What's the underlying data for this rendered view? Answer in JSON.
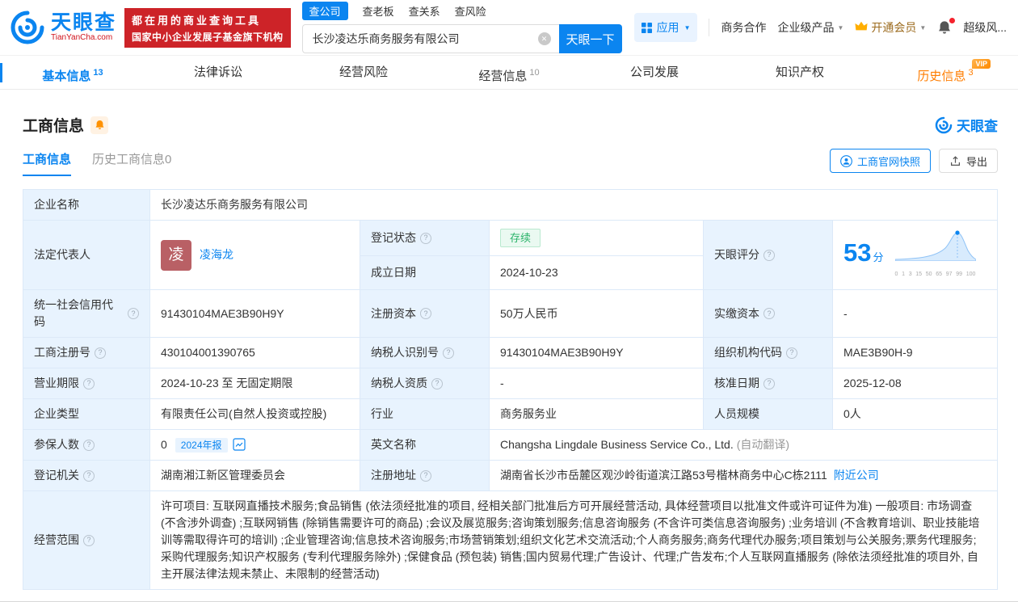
{
  "icons": {
    "help": "?",
    "clear": "✕",
    "caret": "▼"
  },
  "badges": {
    "vip": "VIP"
  },
  "header": {
    "logo_title": "天眼查",
    "logo_domain": "TianYanCha.com",
    "slogan_line1": "都在用的商业查询工具",
    "slogan_line2": "国家中小企业发展子基金旗下机构",
    "search_tabs": [
      {
        "label": "查公司"
      },
      {
        "label": "查老板"
      },
      {
        "label": "查关系"
      },
      {
        "label": "查风险"
      }
    ],
    "search_value": "长沙凌达乐商务服务有限公司",
    "search_button": "天眼一下",
    "nav_app": "应用",
    "nav_cooperation": "商务合作",
    "nav_enterprise": "企业级产品",
    "nav_vip": "开通会员",
    "nav_risk": "超级风..."
  },
  "main_tabs": [
    {
      "label": "基本信息",
      "count": "13"
    },
    {
      "label": "法律诉讼",
      "count": ""
    },
    {
      "label": "经营风险",
      "count": ""
    },
    {
      "label": "经营信息",
      "count": "10"
    },
    {
      "label": "公司发展",
      "count": ""
    },
    {
      "label": "知识产权",
      "count": ""
    },
    {
      "label": "历史信息",
      "count": "3"
    }
  ],
  "section": {
    "title": "工商信息",
    "watermark": "天眼查",
    "subtabs": [
      {
        "label": "工商信息"
      },
      {
        "label": "历史工商信息0"
      }
    ],
    "snapshot_button": "工商官网快照",
    "export_button": "导出"
  },
  "biz": {
    "company_name": {
      "label": "企业名称",
      "value": "长沙凌达乐商务服务有限公司"
    },
    "legal_rep": {
      "label": "法定代表人",
      "avatar": "凌",
      "name": "凌海龙"
    },
    "reg_status": {
      "label": "登记状态",
      "value": "存续"
    },
    "establish_date": {
      "label": "成立日期",
      "value": "2024-10-23"
    },
    "score": {
      "label": "天眼评分",
      "value": "53",
      "unit": "分",
      "ticks": [
        "0",
        "1",
        "3",
        "15",
        "50",
        "65",
        "97",
        "99",
        "100"
      ]
    },
    "credit_code": {
      "label": "统一社会信用代码",
      "value": "91430104MAE3B90H9Y"
    },
    "reg_capital": {
      "label": "注册资本",
      "value": "50万人民币"
    },
    "paid_capital": {
      "label": "实缴资本",
      "value": "-"
    },
    "reg_number": {
      "label": "工商注册号",
      "value": "430104001390765"
    },
    "taxpayer_id": {
      "label": "纳税人识别号",
      "value": "91430104MAE3B90H9Y"
    },
    "org_code": {
      "label": "组织机构代码",
      "value": "MAE3B90H-9"
    },
    "business_term": {
      "label": "营业期限",
      "value": "2024-10-23 至 无固定期限"
    },
    "taxpayer_quality": {
      "label": "纳税人资质",
      "value": "-"
    },
    "approval_date": {
      "label": "核准日期",
      "value": "2025-12-08"
    },
    "company_type": {
      "label": "企业类型",
      "value": "有限责任公司(自然人投资或控股)"
    },
    "industry": {
      "label": "行业",
      "value": "商务服务业"
    },
    "staff_size": {
      "label": "人员规模",
      "value": "0人"
    },
    "insured_count": {
      "label": "参保人数",
      "value": "0",
      "badge": "2024年报"
    },
    "english_name": {
      "label": "英文名称",
      "value": "Changsha Lingdale Business Service Co., Ltd.",
      "note": "(自动翻译)"
    },
    "reg_authority": {
      "label": "登记机关",
      "value": "湖南湘江新区管理委员会"
    },
    "reg_address": {
      "label": "注册地址",
      "value": "湖南省长沙市岳麓区观沙岭街道滨江路53号楷林商务中心C栋2111",
      "link": "附近公司"
    },
    "business_scope": {
      "label": "经营范围",
      "value": "许可项目: 互联网直播技术服务;食品销售 (依法须经批准的项目, 经相关部门批准后方可开展经营活动, 具体经营项目以批准文件或许可证件为准) 一般项目: 市场调查 (不含涉外调查) ;互联网销售 (除销售需要许可的商品) ;会议及展览服务;咨询策划服务;信息咨询服务 (不含许可类信息咨询服务) ;业务培训 (不含教育培训、职业技能培训等需取得许可的培训) ;企业管理咨询;信息技术咨询服务;市场营销策划;组织文化艺术交流活动;个人商务服务;商务代理代办服务;项目策划与公关服务;票务代理服务;采购代理服务;知识产权服务 (专利代理服务除外) ;保健食品 (预包装) 销售;国内贸易代理;广告设计、代理;广告发布;个人互联网直播服务 (除依法须经批准的项目外, 自主开展法律法规未禁止、未限制的经营活动)"
    }
  }
}
